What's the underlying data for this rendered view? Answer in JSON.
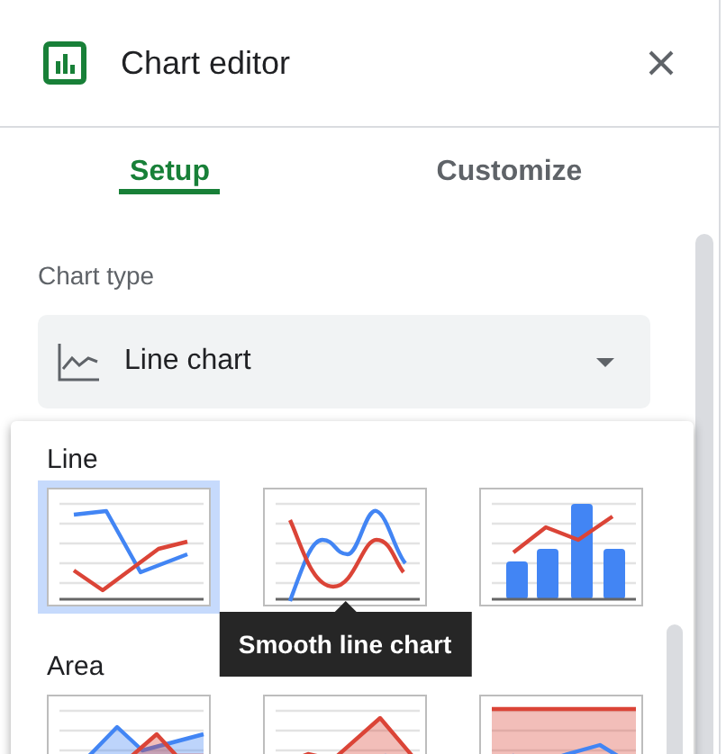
{
  "window": {
    "title": "Chart editor"
  },
  "tabs": [
    {
      "label": "Setup",
      "selected": true
    },
    {
      "label": "Customize",
      "selected": false
    }
  ],
  "chart_type": {
    "label": "Chart type",
    "value": "Line chart"
  },
  "menu": {
    "sections": [
      {
        "title": "Line",
        "items": [
          {
            "kind": "line",
            "selected": true
          },
          {
            "kind": "smooth",
            "selected": false,
            "tooltip": "Smooth line chart"
          },
          {
            "kind": "combo",
            "selected": false
          }
        ]
      },
      {
        "title": "Area",
        "items": [
          {
            "kind": "area",
            "selected": false
          },
          {
            "kind": "stacked",
            "selected": false
          },
          {
            "kind": "percent",
            "selected": false
          }
        ]
      }
    ]
  }
}
